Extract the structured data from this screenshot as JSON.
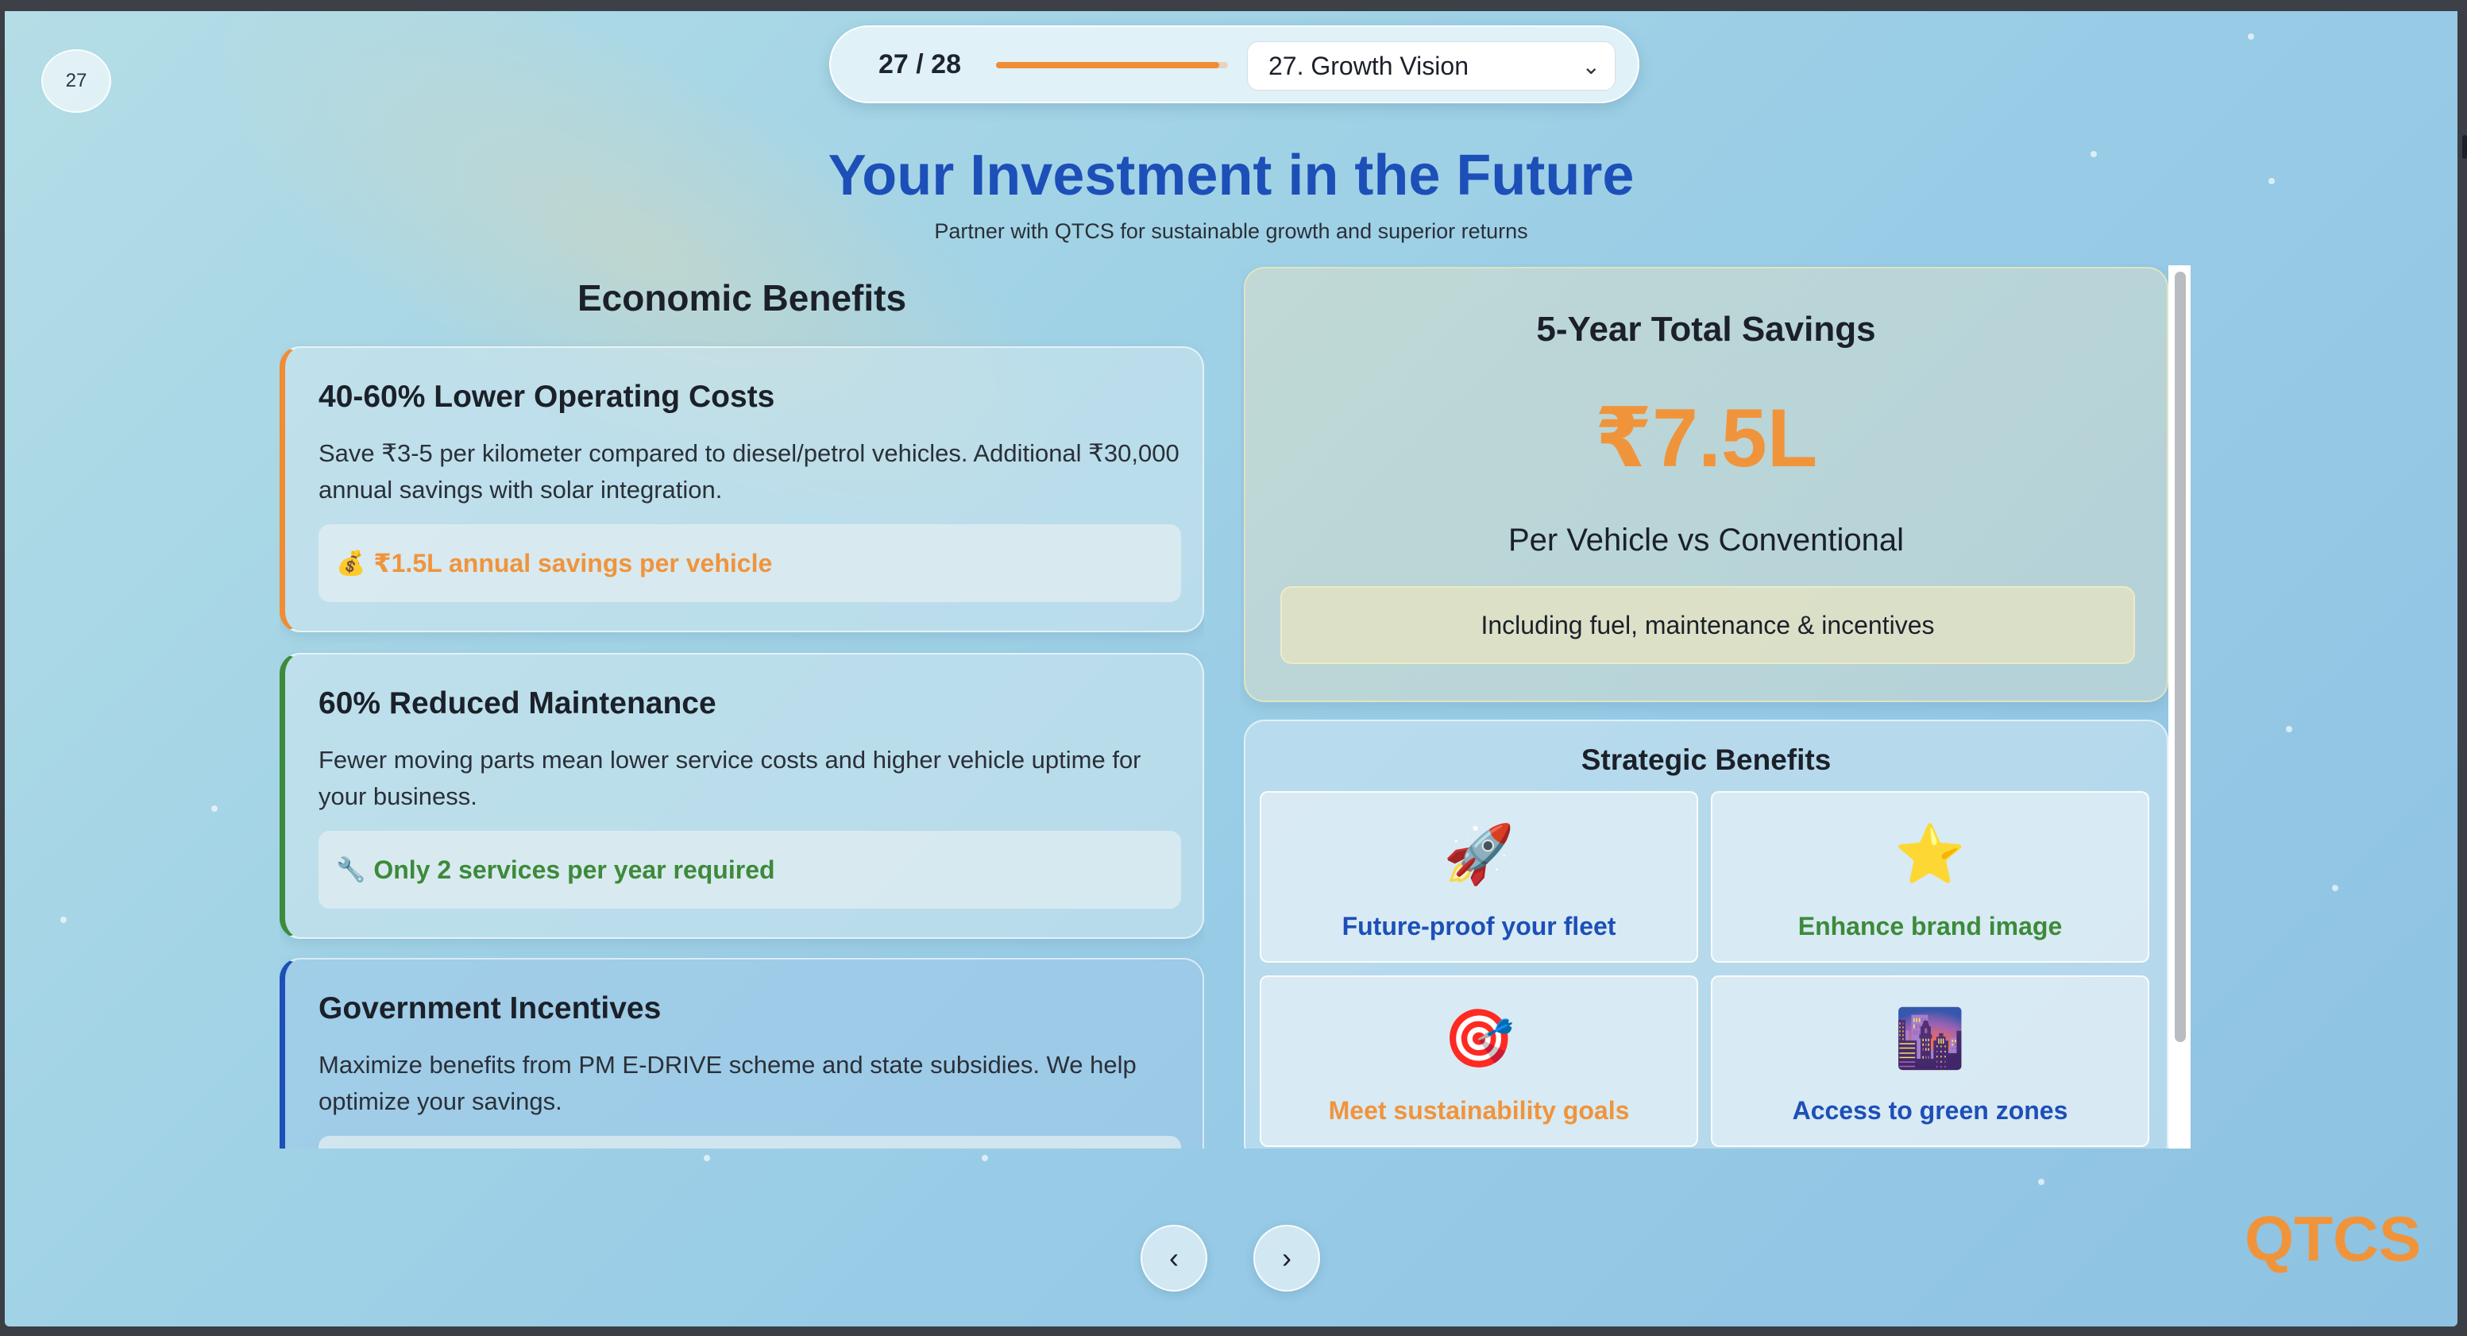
{
  "slide_number": "27",
  "nav": {
    "counter": "27 / 28",
    "progress": 0.964,
    "selected_slide": "27. Growth Vision"
  },
  "header": {
    "title": "Your Investment in the Future",
    "subtitle": "Partner with QTCS for sustainable growth and superior returns"
  },
  "economic": {
    "heading": "Economic Benefits",
    "cards": [
      {
        "title": "40-60% Lower Operating Costs",
        "text": "Save ₹3-5 per kilometer compared to diesel/petrol vehicles. Additional ₹30,000 annual savings with solar integration.",
        "highlight_icon": "💰",
        "highlight": "₹1.5L annual savings per vehicle"
      },
      {
        "title": "60% Reduced Maintenance",
        "text": "Fewer moving parts mean lower service costs and higher vehicle uptime for your business.",
        "highlight_icon": "🔧",
        "highlight": "Only 2 services per year required"
      },
      {
        "title": "Government Incentives",
        "text": "Maximize benefits from PM E-DRIVE scheme and state subsidies. We help optimize your savings."
      }
    ]
  },
  "savings": {
    "heading": "5-Year Total Savings",
    "amount": "₹7.5L",
    "per_vehicle": "Per Vehicle vs Conventional",
    "note": "Including fuel, maintenance & incentives"
  },
  "strategic": {
    "heading": "Strategic Benefits",
    "tiles": [
      {
        "icon": "🚀",
        "label": "Future-proof your fleet",
        "color": "#1d4fb8"
      },
      {
        "icon": "⭐",
        "label": "Enhance brand image",
        "color": "#3d8a3a"
      },
      {
        "icon": "🎯",
        "label": "Meet sustainability goals",
        "color": "#f0943c"
      },
      {
        "icon": "🌆",
        "label": "Access to green zones",
        "color": "#1d4fb8"
      }
    ]
  },
  "controls": {
    "prev": "‹",
    "next": "›"
  },
  "brand": "QTCS",
  "colors": {
    "accent_orange": "#f08c33",
    "accent_blue": "#1d4fb8",
    "accent_green": "#3d8a3a"
  }
}
